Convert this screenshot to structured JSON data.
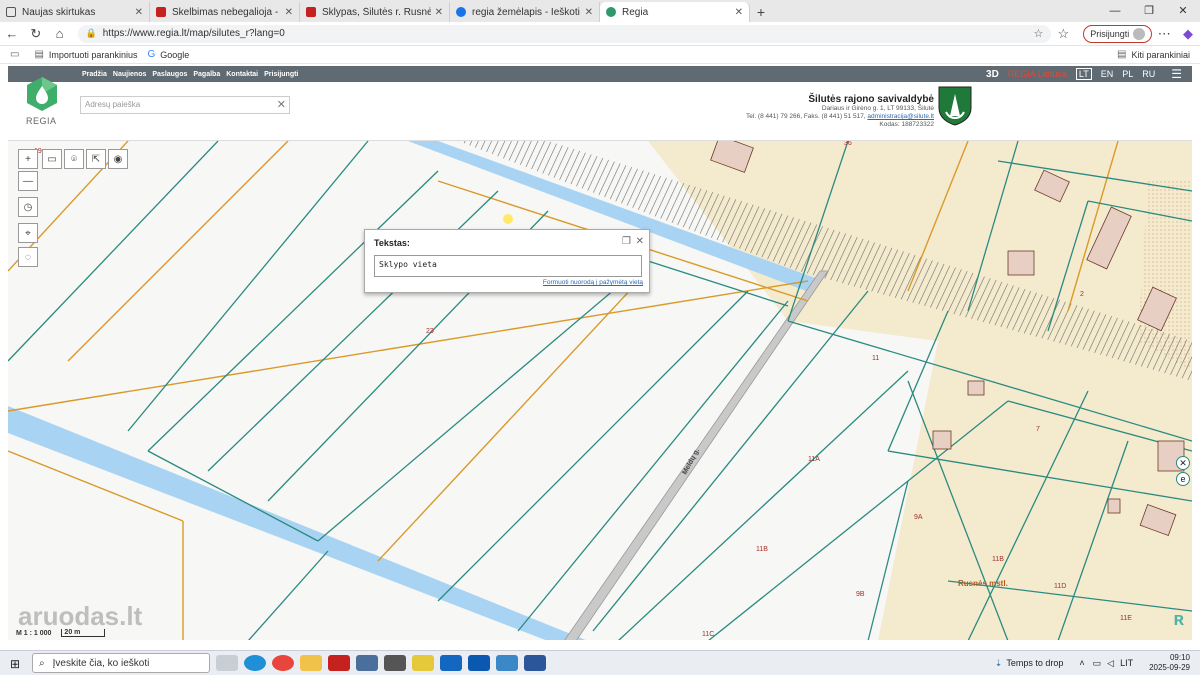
{
  "browser": {
    "tabs": [
      {
        "title": "Naujas skirtukas",
        "color": "#4f4f4f",
        "icon": "page-icon"
      },
      {
        "title": "Skelbimas nebegalioja - laikospre",
        "color": "#c5221f",
        "icon": "gmail-icon"
      },
      {
        "title": "Sklypas, Šilutės r. Rusnės mstl. La",
        "color": "#c5221f",
        "icon": "aruodas-icon"
      },
      {
        "title": "regia žemėlapis - Ieškoti",
        "color": "#1a73e8",
        "icon": "search-icon"
      },
      {
        "title": "Regia",
        "color": "#2e9a6b",
        "icon": "regia-icon",
        "active": true
      }
    ],
    "new_tab": "+",
    "url": "https://www.regia.lt/map/silutes_r?lang=0",
    "signin": "Prisijungti",
    "bookmarks": [
      {
        "label": "Importuoti parankinius"
      },
      {
        "label": "Google"
      }
    ],
    "other_bookmarks": "Kiti parankiniai"
  },
  "site": {
    "nav": [
      "Pradžia",
      "Naujienos",
      "Paslaugos",
      "Pagalba",
      "Kontaktai",
      "Prisijungti"
    ],
    "nav_right": {
      "d3": "3D",
      "brand": "REGIA Lietuva",
      "langs": [
        "LT",
        "EN",
        "PL",
        "RU"
      ]
    },
    "logo_text": "REGIA",
    "search_placeholder": "Adresų paieška",
    "muni": {
      "name": "Šilutės rajono savivaldybė",
      "line1": "Dariaus ir Girėno g. 1, LT 99133, Šilutė",
      "line2_pre": "Tel. (8 441) 79 266, Faks. (8 441) 51 517, ",
      "email": "administracija@silute.lt",
      "line3": "Kodas: 188723322"
    }
  },
  "map": {
    "popup": {
      "title": "Tekstas:",
      "text": "Sklypo vieta",
      "link": "Formuoti nuorodą į pažymėtą vietą"
    },
    "labels": [
      "23",
      "11",
      "11A",
      "9A",
      "11B",
      "11B",
      "11D",
      "9B",
      "11E",
      "11C",
      "7",
      "2",
      "36",
      "19"
    ],
    "street": "Meldų g.",
    "place": "Rusnės mstl.",
    "scale": {
      "ratio": "M 1 : 1 000",
      "bar": "20 m"
    },
    "watermark": "aruodas.lt",
    "colors": {
      "parcel": "#2a8a80",
      "boundary": "#d99a2a",
      "water": "#a9d3f2",
      "built": "#f4ebcf"
    }
  },
  "taskbar": {
    "search": "Įveskite čia, ko ieškoti",
    "weather": "Temps to drop",
    "lang": "LIT",
    "time": "09:10",
    "date": "2025-09-29"
  }
}
